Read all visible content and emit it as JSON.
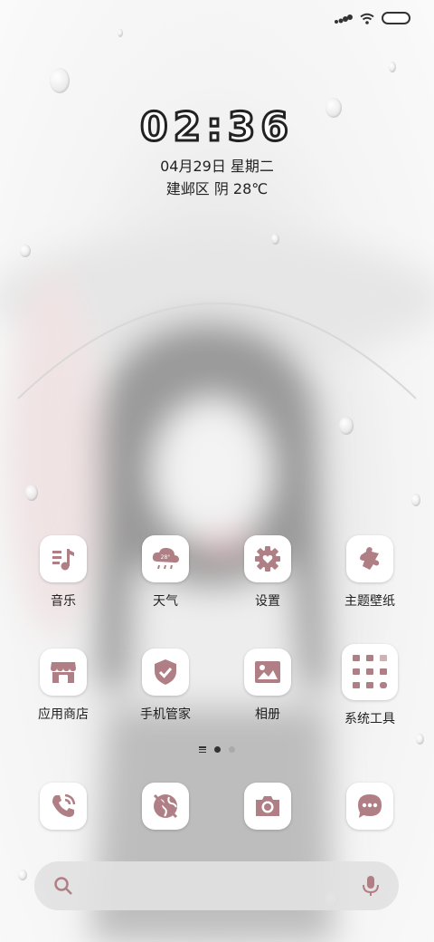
{
  "status_bar": {
    "signal_icon": "signal-icon",
    "wifi_icon": "wifi-icon",
    "battery_icon": "battery-icon"
  },
  "clock": {
    "time": "02:36"
  },
  "date": {
    "text": "04月29日 星期二"
  },
  "weather": {
    "text": "建邺区 阴 28℃"
  },
  "icon_color": "#b07f86",
  "apps_row1": [
    {
      "label": "音乐",
      "icon": "music-icon"
    },
    {
      "label": "天气",
      "icon": "weather-icon",
      "badge": "28°"
    },
    {
      "label": "设置",
      "icon": "gear-icon"
    },
    {
      "label": "主题壁纸",
      "icon": "puzzle-icon"
    }
  ],
  "apps_row2": [
    {
      "label": "应用商店",
      "icon": "store-icon"
    },
    {
      "label": "手机管家",
      "icon": "shield-icon"
    },
    {
      "label": "相册",
      "icon": "gallery-icon"
    },
    {
      "label": "系统工具",
      "icon": "folder-icon"
    }
  ],
  "dock": [
    {
      "name": "phone",
      "icon": "phone-icon"
    },
    {
      "name": "browser",
      "icon": "browser-icon"
    },
    {
      "name": "camera",
      "icon": "camera-icon"
    },
    {
      "name": "messages",
      "icon": "message-icon"
    }
  ],
  "pager": {
    "pages": 2,
    "active": 0
  },
  "search": {
    "search_icon": "search-icon",
    "mic_icon": "mic-icon"
  }
}
